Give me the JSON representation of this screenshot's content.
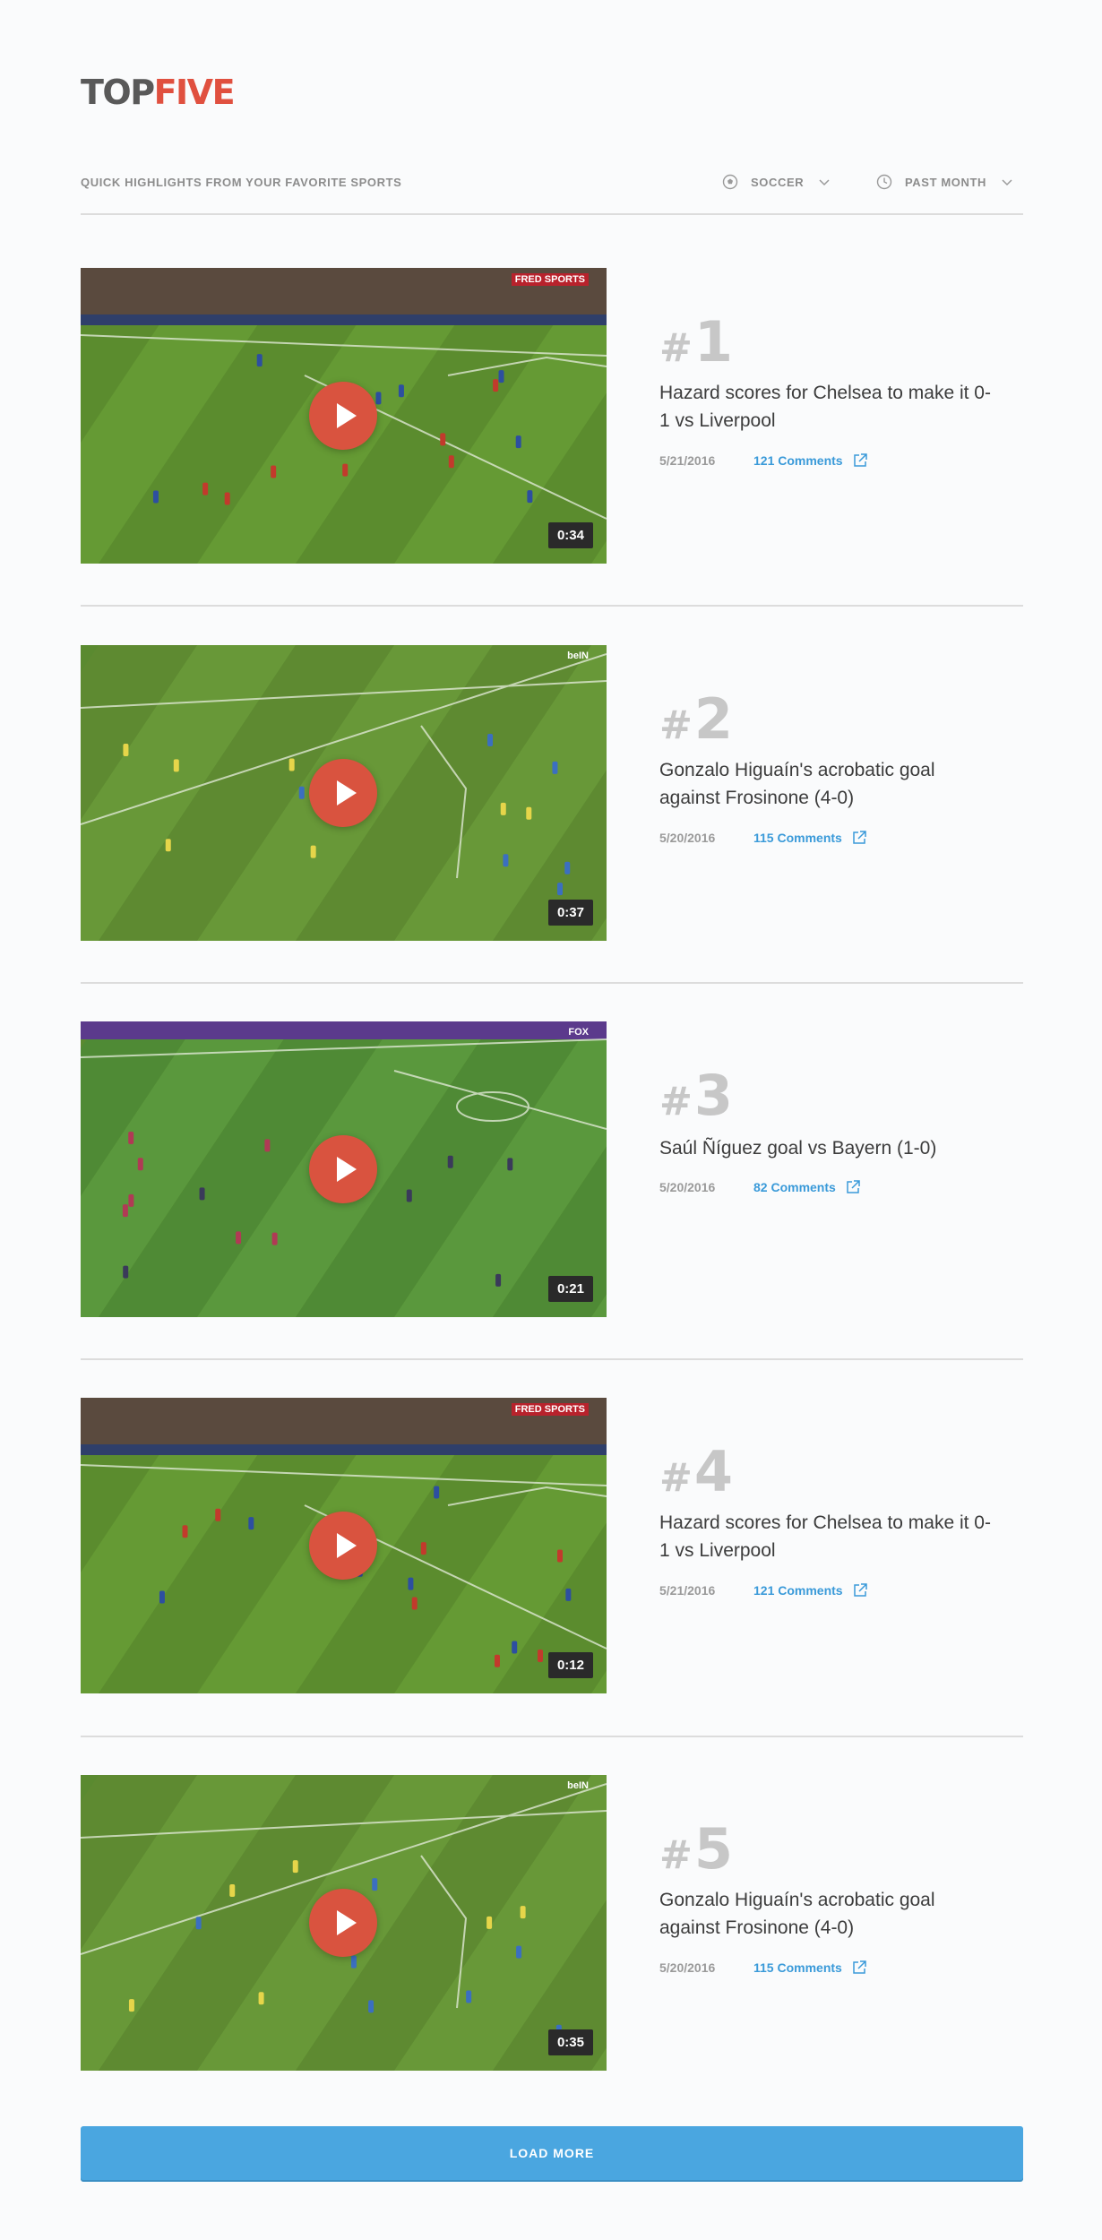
{
  "brand": {
    "logo_top": "TOP",
    "logo_five": "FIVE"
  },
  "toolbar": {
    "tagline": "QUICK HIGHLIGHTS FROM YOUR FAVORITE SPORTS",
    "sport_filter": "SOCCER",
    "time_filter": "PAST MONTH"
  },
  "colors": {
    "accent": "#e0503f",
    "link": "#3a9ad9",
    "button": "#4aa6e0",
    "rank": "#c7c7c7"
  },
  "items": [
    {
      "rank": "1",
      "title": "Hazard scores for Chelsea to make it 0-1 vs Liverpool",
      "date": "5/21/2016",
      "comments": "121 Comments",
      "duration": "0:34",
      "network": "FRED SPORTS"
    },
    {
      "rank": "2",
      "title": "Gonzalo Higuaín's acrobatic goal against Frosinone (4-0)",
      "date": "5/20/2016",
      "comments": "115 Comments",
      "duration": "0:37",
      "network": "beIN"
    },
    {
      "rank": "3",
      "title": "Saúl Ñíguez goal vs Bayern (1-0)",
      "date": "5/20/2016",
      "comments": "82 Comments",
      "duration": "0:21",
      "network": "FOX"
    },
    {
      "rank": "4",
      "title": "Hazard scores for Chelsea to make it 0-1 vs Liverpool",
      "date": "5/21/2016",
      "comments": "121 Comments",
      "duration": "0:12",
      "network": "FRED SPORTS"
    },
    {
      "rank": "5",
      "title": "Gonzalo Higuaín's acrobatic goal against Frosinone (4-0)",
      "date": "5/20/2016",
      "comments": "115 Comments",
      "duration": "0:35",
      "network": "beIN"
    }
  ],
  "load_more": "LOAD MORE"
}
